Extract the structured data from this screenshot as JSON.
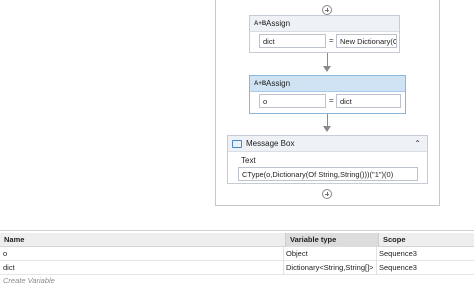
{
  "designer": {
    "activities": [
      {
        "title": "Assign",
        "icon": "assign-icon",
        "icon_text": "A+B",
        "left": "dict",
        "equals": "=",
        "right": "New Dictionary(Of"
      },
      {
        "title": "Assign",
        "icon": "assign-icon",
        "icon_text": "A+B",
        "left": "o",
        "equals": "=",
        "right": "dict"
      }
    ],
    "message_box": {
      "title": "Message Box",
      "icon": "message-box-icon",
      "collapse_glyph": "⌃",
      "field_label": "Text",
      "text_value": "CType(o,Dictionary(Of String,String()))(\"1\")(0)"
    }
  },
  "variables": {
    "columns": [
      "Name",
      "Variable type",
      "Scope"
    ],
    "rows": [
      {
        "name": "o",
        "type": "Object",
        "scope": "Sequence3"
      },
      {
        "name": "dict",
        "type": "Dictionary<String,String[]>",
        "scope": "Sequence3"
      }
    ],
    "create_placeholder": "Create Variable"
  }
}
